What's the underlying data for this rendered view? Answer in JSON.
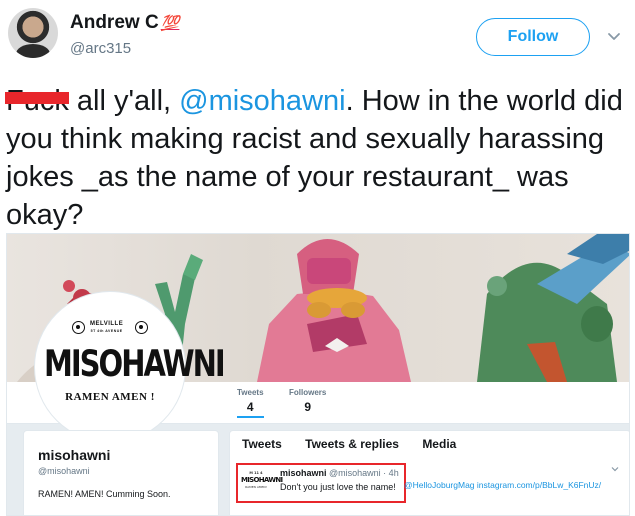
{
  "author": {
    "name": "Andrew C",
    "emoji": "💯",
    "handle": "@arc315",
    "avatar_icon": "person-avatar",
    "follow_label": "Follow",
    "menu_icon": "chevron-down-icon"
  },
  "tweet": {
    "censored_word": "Fuck",
    "part1": " all y'all, ",
    "mention": "@misohawni",
    "part2": ". How in the world did you think making racist and sexually harassing jokes _as the name of your restaurant_ was okay?"
  },
  "screenshot": {
    "profile": {
      "logo_small": "MELVILLE",
      "logo_small2": "5T  4th AVENUE",
      "logo_main": "MISOHAWNI",
      "logo_sub": "RAMEN  AMEN !",
      "name": "misohawni",
      "handle": "@misohawni",
      "bio": "RAMEN! AMEN! Cumming Soon."
    },
    "stats": {
      "tweets_label": "Tweets",
      "tweets_value": "4",
      "followers_label": "Followers",
      "followers_value": "9"
    },
    "tabs": [
      "Tweets",
      "Tweets & replies",
      "Media"
    ],
    "embedded_tweet": {
      "mini_logo_top": "M 11 4",
      "mini_logo_main": "MISOHAWNI",
      "mini_logo_sub": "RAMEN AMEN!",
      "name": "misohawni",
      "meta": "@misohawni · 4h",
      "text": "Don't you just love the name!",
      "link": "@HelloJoburgMag instagram.com/p/BbLw_K6FnUz/"
    },
    "highlight_color": "#e8262b"
  },
  "colors": {
    "accent": "#1da1f2",
    "mention": "#1b95e0",
    "censor": "#e8262b"
  }
}
